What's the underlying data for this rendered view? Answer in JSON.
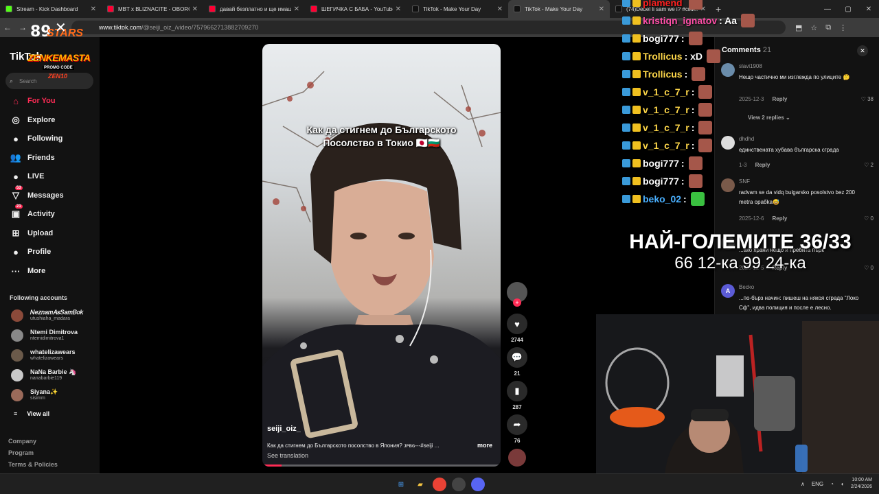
{
  "browser": {
    "tabs": [
      {
        "title": "Stream - Kick Dashboard",
        "color": "#53fc18"
      },
      {
        "title": "MBT x BLIZNACITE - OBOROTI",
        "color": "#ff0033"
      },
      {
        "title": "давай безплатно и ще имаш",
        "color": "#ff0033"
      },
      {
        "title": "ШЕГИЧКА С БАБА - YouTube",
        "color": "#ff0033"
      },
      {
        "title": "TikTok - Make Your Day",
        "color": "#111111"
      },
      {
        "title": "TikTok - Make Your Day",
        "color": "#111111"
      },
      {
        "title": "(74)Debel li sam we i? #сми..",
        "color": "#111111"
      }
    ],
    "url_host": "www.tiktok.com",
    "url_path": "/@seiji_oiz_/video/7579662713882709270"
  },
  "tiktok": {
    "logo": "TikTok",
    "search_placeholder": "Search",
    "nav": [
      {
        "label": "For You",
        "icon": "home-icon",
        "glyph": "⌂"
      },
      {
        "label": "Explore",
        "icon": "compass-icon",
        "glyph": "◎"
      },
      {
        "label": "Following",
        "icon": "following-icon",
        "glyph": "●"
      },
      {
        "label": "Friends",
        "icon": "friends-icon",
        "glyph": "👥"
      },
      {
        "label": "LIVE",
        "icon": "live-icon",
        "glyph": "●"
      },
      {
        "label": "Messages",
        "icon": "messages-icon",
        "glyph": "▽",
        "badge": "53"
      },
      {
        "label": "Activity",
        "icon": "activity-icon",
        "glyph": "▣",
        "badge": "21"
      },
      {
        "label": "Upload",
        "icon": "upload-icon",
        "glyph": "⊞"
      },
      {
        "label": "Profile",
        "icon": "profile-icon",
        "glyph": "●"
      },
      {
        "label": "More",
        "icon": "more-icon",
        "glyph": "···"
      }
    ],
    "following_header": "Following accounts",
    "accounts": [
      {
        "name": "𝑁𝑒𝑧𝑛𝑎𝑚𝐴𝑠𝑆𝑎𝑚𝐵𝑜𝑘",
        "handle": "utushiaha_madara",
        "color": "#8b4a3a"
      },
      {
        "name": "Ntemi Dimitrova",
        "handle": "ntemidimitrova1",
        "color": "#888888"
      },
      {
        "name": "whatelizawears",
        "handle": "whatelizawears",
        "color": "#6b5a4a"
      },
      {
        "name": "NaNa Barbie 🦄",
        "handle": "nanabarbie119",
        "color": "#c8c8c8"
      },
      {
        "name": "Siyana✨",
        "handle": "sisimm",
        "color": "#9a6a5a"
      }
    ],
    "view_all": "View all",
    "footer": [
      "Company",
      "Program",
      "Terms & Policies"
    ]
  },
  "overlay": {
    "logo_stars": "STARS",
    "logo_zen": "ZENKEMASTA",
    "promo": "PROMO CODE",
    "promo_code": "ZEN10"
  },
  "video": {
    "caption_line1": "Как да стигнем до Българското",
    "caption_line2": "Посолство в Токио 🇯🇵🇧🇬",
    "username": "seiji_oiz_",
    "description": "Как да стигнем до Българското посолство в Япония? ᴊᴘʙɢ---#seiji ...",
    "more": "more",
    "see_translation": "See translation",
    "progress": 0.08,
    "actions": [
      {
        "icon": "heart-icon",
        "glyph": "♥",
        "count": "2744"
      },
      {
        "icon": "comment-icon",
        "glyph": "💬",
        "count": "21"
      },
      {
        "icon": "bookmark-icon",
        "glyph": "▮",
        "count": "287"
      },
      {
        "icon": "share-icon",
        "glyph": "➦",
        "count": "76"
      }
    ]
  },
  "comments": {
    "title": "Comments",
    "count": "21",
    "items": [
      {
        "user": "slavi1908",
        "text": "Нещо частично ми изглежда по улиците 🤔",
        "date": "2025-12-3",
        "reply": "Reply",
        "likes": "38",
        "color": "#6a8caa"
      },
      {
        "user": "dhdhd",
        "text": "единствената хубава българска сграда",
        "date": "1-3",
        "reply": "Reply",
        "likes": "2",
        "color": "#dddddd"
      },
      {
        "user": "SNF",
        "text": "radvam se da vidq bulgarsko posolstvo bez 200 metra opaбka😅",
        "date": "2025-12-6",
        "reply": "Reply",
        "likes": "0",
        "color": "#7a5a4a"
      },
      {
        "user": "",
        "text": "...ако храни нещо и пребита пърк",
        "date": "2025-12-5",
        "reply": "Reply",
        "likes": "0",
        "color": "#444444"
      },
      {
        "user": "Becko",
        "text": "...по-бърз начин: пишеш на някоя сграда \"Локо Сф\", идва полиция и после е лесно.",
        "date": "",
        "reply": "",
        "likes": "",
        "color": "#5b5bd6",
        "initial": "A"
      }
    ],
    "view_replies": "View 2 replies"
  },
  "chat": [
    {
      "name": "plamend",
      "msg": "",
      "color": "#ff2020"
    },
    {
      "name": "kristiqn_ignatov",
      "msg": ": Aa",
      "color": "#ff4fa8"
    },
    {
      "name": "bogi777",
      "msg": ":",
      "color": "#ffffff"
    },
    {
      "name": "Trollicus",
      "msg": ": xD",
      "color": "#ffd84a"
    },
    {
      "name": "Trollicus",
      "msg": ":",
      "color": "#ffd84a"
    },
    {
      "name": "v_1_c_7_r",
      "msg": ":",
      "color": "#ffd84a"
    },
    {
      "name": "v_1_c_7_r",
      "msg": ":",
      "color": "#ffd84a"
    },
    {
      "name": "v_1_c_7_r",
      "msg": ":",
      "color": "#ffd84a"
    },
    {
      "name": "v_1_c_7_r",
      "msg": ":",
      "color": "#ffd84a"
    },
    {
      "name": "bogi777",
      "msg": ":",
      "color": "#ffffff"
    },
    {
      "name": "bogi777",
      "msg": ":",
      "color": "#ffffff"
    },
    {
      "name": "beko_02",
      "msg": ":",
      "color": "#4ab0ff"
    }
  ],
  "big_overlay": {
    "line1": "НАЙ-ГОЛЕМИТЕ 36/33",
    "line2": "66 12-ка 99 24-ка"
  },
  "taskbar": {
    "lang": "ENG",
    "time": "10:00 AM",
    "date": "2/24/2026"
  }
}
